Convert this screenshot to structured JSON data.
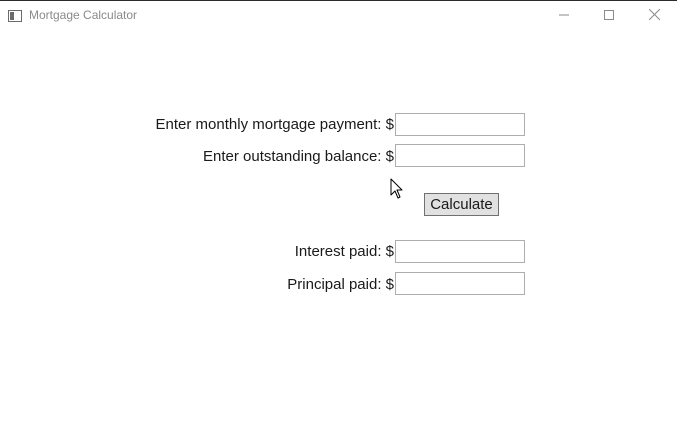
{
  "window": {
    "title": "Mortgage Calculator"
  },
  "form": {
    "monthly_payment_label": "Enter monthly mortgage payment: $",
    "monthly_payment_value": "",
    "balance_label": "Enter outstanding balance: $",
    "balance_value": "",
    "calculate_label": "Calculate",
    "interest_label": "Interest paid: $",
    "interest_value": "",
    "principal_label": "Principal paid: $",
    "principal_value": ""
  }
}
